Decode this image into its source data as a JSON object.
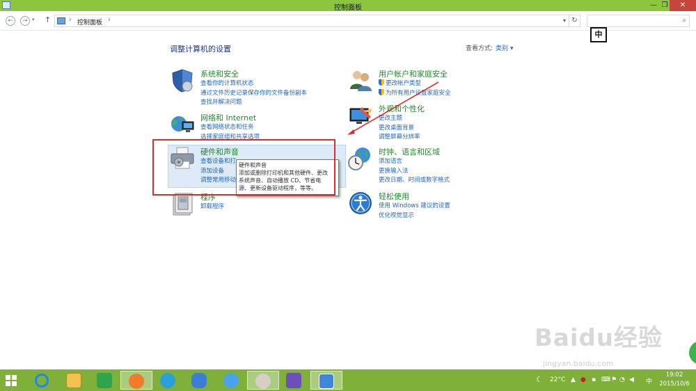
{
  "window": {
    "title": "控制面板",
    "buttons": {
      "minimize": "—",
      "maximize": "❐",
      "close": "✕"
    }
  },
  "address_bar": {
    "breadcrumb": "控制面板",
    "back": "←",
    "forward": "→",
    "up": "↑",
    "refresh": "↻",
    "search_placeholder": "",
    "search_icon": "search-icon"
  },
  "ime_indicator": "中",
  "main": {
    "heading": "调整计算机的设置",
    "view_by_label": "查看方式:",
    "view_by_value": "类别",
    "view_by_arrow": "▾",
    "categories_left": [
      {
        "title": "系统和安全",
        "icon": "shield-icon",
        "links": [
          "查看你的计算机状态",
          "通过文件历史记录保存你的文件备份副本",
          "查找并解决问题"
        ]
      },
      {
        "title": "网络和 Internet",
        "icon": "network-icon",
        "links": [
          "查看网络状态和任务",
          "选择家庭组和共享选项"
        ]
      },
      {
        "title": "硬件和声音",
        "icon": "printer-icon",
        "links": [
          "查看设备和打",
          "添加设备",
          "调整常用移动"
        ]
      },
      {
        "title": "程序",
        "icon": "programs-icon",
        "links": [
          "卸载程序"
        ]
      }
    ],
    "categories_right": [
      {
        "title": "用户帐户和家庭安全",
        "icon": "users-icon",
        "links": [
          "更改帐户类型",
          "为所有用户设置家庭安全"
        ]
      },
      {
        "title": "外观和个性化",
        "icon": "appearance-icon",
        "links": [
          "更改主题",
          "更改桌面背景",
          "调整屏幕分辨率"
        ]
      },
      {
        "title": "时钟、语言和区域",
        "icon": "clock-globe-icon",
        "links": [
          "添加语言",
          "更换输入法",
          "更改日期、时间或数字格式"
        ]
      },
      {
        "title": "轻松使用",
        "icon": "ease-of-access-icon",
        "links": [
          "使用 Windows 建议的设置",
          "优化视觉显示"
        ]
      }
    ],
    "tooltip": {
      "title": "硬件和声音",
      "body_lines": [
        "添加或删除打印机和其他硬件、更改",
        "系统声音、自动播放 CD、节省电",
        "源、更新设备驱动程序，等等。"
      ]
    }
  },
  "watermark": {
    "main": "Baidu经验",
    "sub": "jingyan.baidu.com"
  },
  "taskbar": {
    "items": [
      "start-icon",
      "ie-icon",
      "explorer-icon",
      "store-icon",
      "app-orange-icon",
      "browser-icon",
      "cloud-icon",
      "baidu-app-icon",
      "paint-icon",
      "settings-icon",
      "control-panel-icon"
    ],
    "tray": {
      "weather": "22°C",
      "ime": "中",
      "time": "19:02",
      "date": "2015/10/6"
    }
  },
  "colors": {
    "title_bar": "#8cc63f",
    "taskbar": "#7fb03a",
    "category_title": "#1f8a2e",
    "link": "#2166c2",
    "annotation_red": "#e02b2b"
  }
}
